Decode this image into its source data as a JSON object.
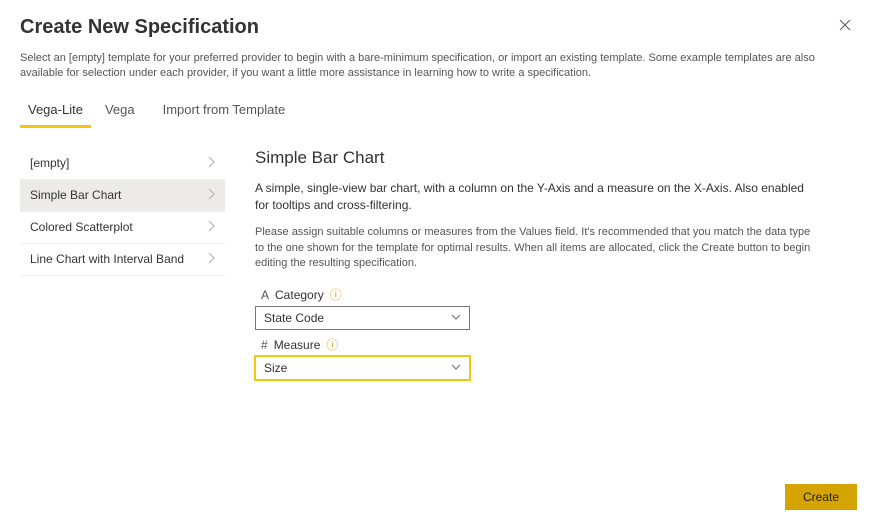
{
  "header": {
    "title": "Create New Specification",
    "subtitle": "Select an [empty] template for your preferred provider to begin with a bare-minimum specification, or import an existing template. Some example templates are also available for selection under each provider, if you want a little more assistance in learning how to write a specification."
  },
  "tabs": {
    "items": [
      "Vega-Lite",
      "Vega",
      "Import from Template"
    ],
    "active": 0
  },
  "templates": {
    "items": [
      {
        "label": "[empty]"
      },
      {
        "label": "Simple Bar Chart"
      },
      {
        "label": "Colored Scatterplot"
      },
      {
        "label": "Line Chart with Interval Band"
      }
    ],
    "selected": 1
  },
  "detail": {
    "title": "Simple Bar Chart",
    "description": "A simple, single-view bar chart, with a column on the Y-Axis and a measure on the X-Axis. Also enabled for tooltips and cross-filtering.",
    "hint": "Please assign suitable columns or measures from the Values field. It's recommended that you match the data type to the one shown for the template for optimal results. When all items are allocated, click the Create button to begin editing the resulting specification.",
    "fields": [
      {
        "icon": "text-icon",
        "label": "Category",
        "value": "State Code"
      },
      {
        "icon": "hash-icon",
        "label": "Measure",
        "value": "Size"
      }
    ]
  },
  "footer": {
    "create_label": "Create"
  },
  "icons": {
    "text_glyph": "A",
    "hash_glyph": "#",
    "info_glyph": "ⓘ"
  }
}
